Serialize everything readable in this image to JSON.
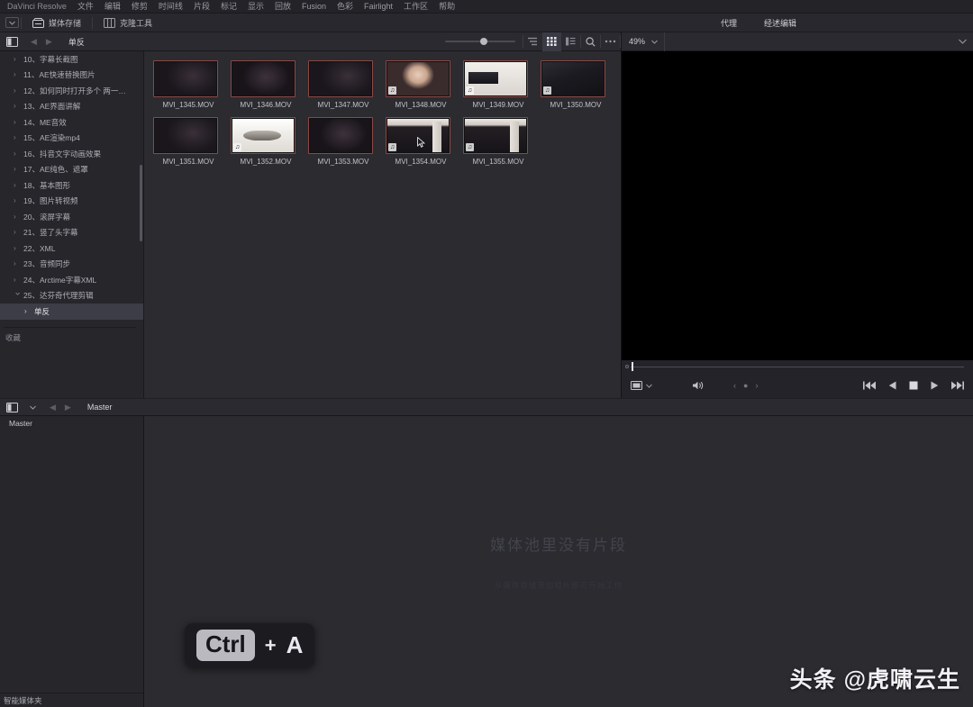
{
  "app": {
    "brand": "DaVinci Resolve"
  },
  "menubar": {
    "items": [
      {
        "label": "DaVinci Resolve"
      },
      {
        "label": "文件"
      },
      {
        "label": "编辑"
      },
      {
        "label": "修剪"
      },
      {
        "label": "时间线"
      },
      {
        "label": "片段"
      },
      {
        "label": "标记"
      },
      {
        "label": "显示"
      },
      {
        "label": "回放"
      },
      {
        "label": "Fusion"
      },
      {
        "label": "色彩"
      },
      {
        "label": "Fairlight"
      },
      {
        "label": "工作区"
      },
      {
        "label": "帮助"
      }
    ]
  },
  "toolbar": {
    "media_storage_label": "媒体存储",
    "clone_tool_label": "克隆工具"
  },
  "top_right": {
    "proxy_label": "代理",
    "timeline_label": "经述编辑"
  },
  "media_storage": {
    "title": "单反",
    "tree": {
      "items": [
        {
          "label": "10、字幕长截图"
        },
        {
          "label": "11、AE快速替换图片"
        },
        {
          "label": "12、如何同时打开多个 两一…"
        },
        {
          "label": "13、AE界面讲解"
        },
        {
          "label": "14、ME音效"
        },
        {
          "label": "15、AE渲染mp4"
        },
        {
          "label": "16、抖音文字动画效果"
        },
        {
          "label": "17、AE纯色、遮罩"
        },
        {
          "label": "18、基本图形"
        },
        {
          "label": "19、图片转视频"
        },
        {
          "label": "20、滚屏字幕"
        },
        {
          "label": "21、竖了头字幕"
        },
        {
          "label": "22、XML"
        },
        {
          "label": "23、音频同步"
        },
        {
          "label": "24、Arctime字幕XML"
        },
        {
          "label": "25、达芬奇代理剪辑",
          "expanded": true
        },
        {
          "label": "单反",
          "selected": true
        }
      ],
      "favorites_label": "收藏"
    },
    "zoom_slider_value": 50,
    "view_modes": [
      {
        "name": "list-view",
        "active": false
      },
      {
        "name": "grid-view",
        "active": true
      },
      {
        "name": "metadata-view",
        "active": false
      }
    ],
    "clips": [
      {
        "name": "MVI_1345.MOV",
        "scene": "sc-room",
        "audio": false,
        "selected": true,
        "cursor": false
      },
      {
        "name": "MVI_1346.MOV",
        "scene": "sc-room2",
        "audio": false,
        "selected": true,
        "cursor": false
      },
      {
        "name": "MVI_1347.MOV",
        "scene": "sc-room",
        "audio": false,
        "selected": true,
        "cursor": false
      },
      {
        "name": "MVI_1348.MOV",
        "scene": "sc-portrait",
        "audio": true,
        "selected": true,
        "cursor": false
      },
      {
        "name": "MVI_1349.MOV",
        "scene": "sc-desk",
        "audio": true,
        "selected": true,
        "cursor": false
      },
      {
        "name": "MVI_1350.MOV",
        "scene": "sc-dark",
        "audio": true,
        "selected": true,
        "cursor": false
      },
      {
        "name": "MVI_1351.MOV",
        "scene": "sc-room",
        "audio": false,
        "selected": true,
        "cursor": false
      },
      {
        "name": "MVI_1352.MOV",
        "scene": "sc-shoe",
        "audio": true,
        "selected": true,
        "cursor": false
      },
      {
        "name": "MVI_1353.MOV",
        "scene": "sc-room2",
        "audio": false,
        "selected": true,
        "cursor": false
      },
      {
        "name": "MVI_1354.MOV",
        "scene": "sc-floor",
        "audio": true,
        "selected": true,
        "cursor": true
      },
      {
        "name": "MVI_1355.MOV",
        "scene": "sc-floor",
        "audio": true,
        "selected": true,
        "cursor": false
      }
    ]
  },
  "viewer": {
    "zoom_level": "49%",
    "clip_name": ""
  },
  "media_pool": {
    "breadcrumb": "Master",
    "tree_items": [
      {
        "label": "Master"
      }
    ],
    "empty_title": "媒体池里没有片段",
    "empty_subtitle": "从媒体存储添加短片即可开始工作",
    "smart_bins_label": "智能媒体夹"
  },
  "key_overlay": {
    "modifier": "Ctrl",
    "plus": "+",
    "key": "A"
  },
  "watermark": {
    "text": "头条 @虎啸云生"
  },
  "colors": {
    "selection_border": "#8a4a46",
    "panel_bg": "#2b2b30",
    "header_bg": "#2a2a30",
    "text": "#c8c8cc"
  }
}
